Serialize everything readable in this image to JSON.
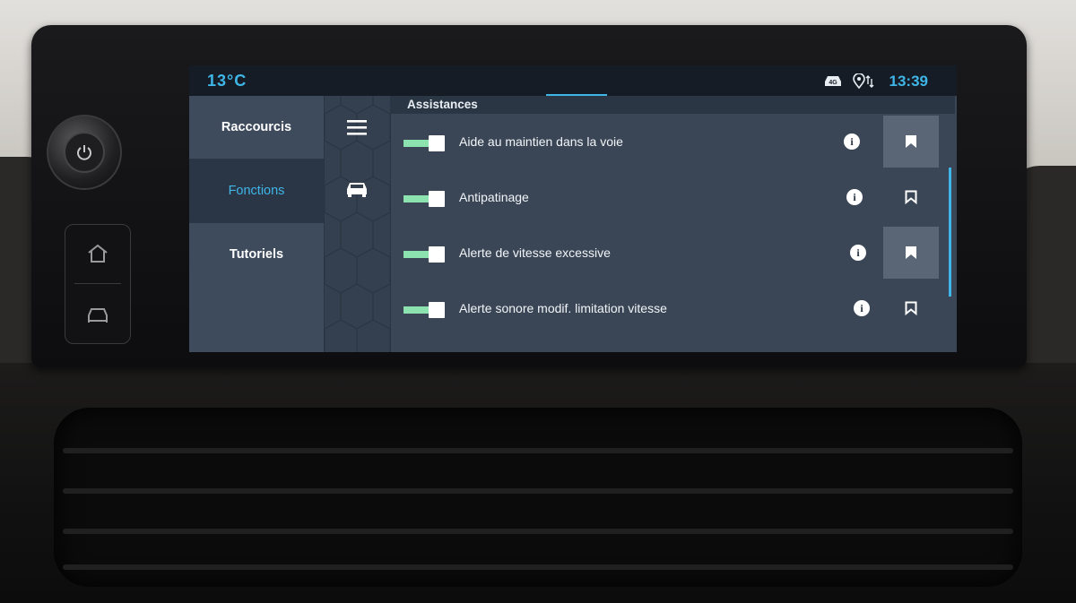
{
  "status_bar": {
    "temperature": "13°C",
    "time": "13:39",
    "icons": [
      "car-4g-icon",
      "location-sync-icon"
    ],
    "network_badge": "4G",
    "accent_color": "#3fb6e8"
  },
  "left_nav": {
    "items": [
      {
        "label": "Raccourcis",
        "active": false
      },
      {
        "label": "Fonctions",
        "active": true
      },
      {
        "label": "Tutoriels",
        "active": false
      }
    ]
  },
  "icon_column": {
    "icons": [
      "menu-icon",
      "car-icon"
    ]
  },
  "content": {
    "section_title": "Assistances",
    "rows": [
      {
        "label": "Aide au maintien dans la voie",
        "enabled": true,
        "favorite": true
      },
      {
        "label": "Antipatinage",
        "enabled": true,
        "favorite": false
      },
      {
        "label": "Alerte de vitesse excessive",
        "enabled": true,
        "favorite": true
      },
      {
        "label": "Alerte sonore modif. limitation vitesse",
        "enabled": true,
        "favorite": false
      }
    ],
    "info_glyph": "i"
  },
  "hardware": {
    "buttons": [
      "power-icon",
      "home-icon",
      "car-icon"
    ]
  }
}
